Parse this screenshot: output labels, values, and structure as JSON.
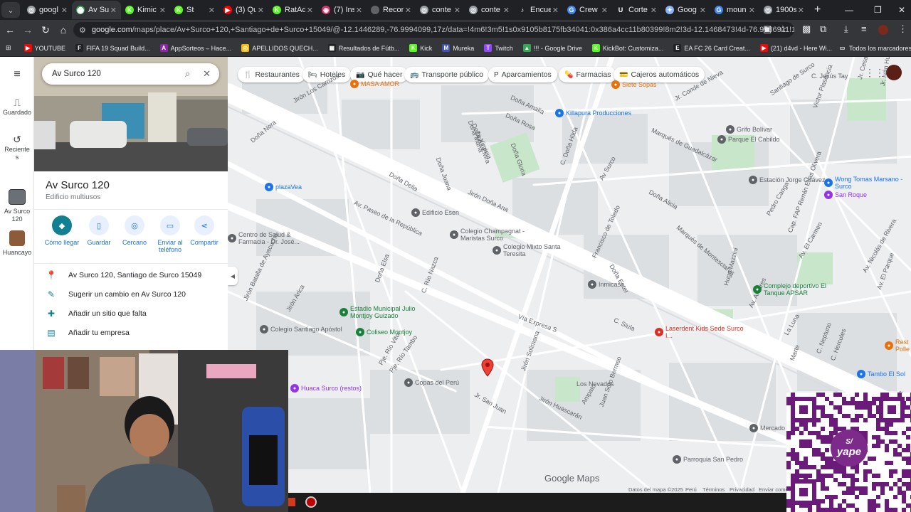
{
  "browser": {
    "tabs": [
      {
        "label": "googl",
        "color": "#9aa0a6",
        "glyph": "◎"
      },
      {
        "label": "Av Su",
        "color": "#34a853",
        "glyph": "⬤",
        "active": true
      },
      {
        "label": "Kimic",
        "color": "#53fc18",
        "glyph": "K"
      },
      {
        "label": "St",
        "color": "#53fc18",
        "glyph": "K"
      },
      {
        "label": "(3) Qu",
        "color": "#ff0000",
        "glyph": "▶"
      },
      {
        "label": "RatAd",
        "color": "#53fc18",
        "glyph": "K"
      },
      {
        "label": "(7) Ins",
        "color": "#e1306c",
        "glyph": "◉"
      },
      {
        "label": "Recon",
        "color": "#5f6368",
        "glyph": ""
      },
      {
        "label": "conte",
        "color": "#9aa0a6",
        "glyph": "◎"
      },
      {
        "label": "conte",
        "color": "#9aa0a6",
        "glyph": "◎"
      },
      {
        "label": "Encue",
        "color": "#202124",
        "glyph": "♪"
      },
      {
        "label": "Crew",
        "color": "#4285f4",
        "glyph": "G"
      },
      {
        "label": "Corte",
        "color": "#202124",
        "glyph": "U"
      },
      {
        "label": "Goog",
        "color": "#8ab4f8",
        "glyph": "✦"
      },
      {
        "label": "moun",
        "color": "#4285f4",
        "glyph": "G"
      },
      {
        "label": "1900s",
        "color": "#9aa0a6",
        "glyph": "◎"
      }
    ],
    "url_domain": "google.com",
    "url_rest": "/maps/place/Av+Surco+120,+Santiago+de+Surco+15049/@-12.1446289,-76.9994099,17z/data=!4m6!3m5!1s0x9105b8175fb34041:0x386a4cc11b80399!8m2!3d-12.1468473!4d-76.9986911!16s%2Fg%2F11j4x6zwd...",
    "bookmarks": [
      {
        "label": "YOUTUBE",
        "color": "#ff0000",
        "glyph": "▶"
      },
      {
        "label": "FIFA 19 Squad Build...",
        "color": "#202124",
        "glyph": "F"
      },
      {
        "label": "AppSorteos – Hace...",
        "color": "#8e24aa",
        "glyph": "A"
      },
      {
        "label": "APELLIDOS QUECH...",
        "color": "#fbbc04",
        "glyph": "◎"
      },
      {
        "label": "Resultados de Fútb...",
        "color": "#202124",
        "glyph": "▦"
      },
      {
        "label": "Kick",
        "color": "#53fc18",
        "glyph": "K"
      },
      {
        "label": "Mureka",
        "color": "#3f51b5",
        "glyph": "M"
      },
      {
        "label": "Twitch",
        "color": "#9146ff",
        "glyph": "T"
      },
      {
        "label": "!!! - Google Drive",
        "color": "#34a853",
        "glyph": "▲"
      },
      {
        "label": "KickBot: Customiza...",
        "color": "#53fc18",
        "glyph": "K"
      },
      {
        "label": "EA FC 26 Card Creat...",
        "color": "#202124",
        "glyph": "E"
      },
      {
        "label": "(21) d4vd - Here Wi...",
        "color": "#ff0000",
        "glyph": "▶"
      }
    ],
    "all_bookmarks": "Todos los marcadores"
  },
  "rail": {
    "saved": "Guardado",
    "recent": "Recientes",
    "recent_place": "Av Surco 120",
    "huancayo": "Huancayo"
  },
  "panel": {
    "search_value": "Av Surco 120",
    "title": "Av Surco 120",
    "subtitle": "Edificio multiusos",
    "actions": [
      {
        "label": "Cómo llegar",
        "icon": "◆"
      },
      {
        "label": "Guardar",
        "icon": "▯"
      },
      {
        "label": "Cercano",
        "icon": "◎"
      },
      {
        "label": "Enviar al teléfono",
        "icon": "▭"
      },
      {
        "label": "Compartir",
        "icon": "⋖"
      }
    ],
    "rows": [
      {
        "text": "Av Surco 120, Santiago de Surco 15049",
        "icon": "📍"
      },
      {
        "text": "Sugerir un cambio en Av Surco 120",
        "icon": "✎"
      },
      {
        "text": "Añadir un sitio que falta",
        "icon": "✚"
      },
      {
        "text": "Añadir tu empresa",
        "icon": "▤"
      }
    ]
  },
  "map": {
    "chips": [
      "Restaurantes",
      "Hoteles",
      "Qué hacer",
      "Transporte público",
      "Aparcamientos",
      "Farmacias",
      "Cajeros automáticos"
    ],
    "pois": [
      "MASA AMOR",
      "Siete Sopas",
      "Killapura Producciones",
      "Grifo Bolívar",
      "Parque El Cabildo",
      "Estación Jorge Chávez",
      "Wong Tomas Marsano - Surco",
      "San Roque",
      "plazaVea",
      "Edificio Esen",
      "Colegio Champagnat - Maristas Surco",
      "Colegio Mixto Santa Teresita",
      "Inmicash",
      "Complejo deportivo El Tanque APSAR",
      "Laserdent Kids Sede Surco I...",
      "Estadio Municipal Julio Montjoy Guizado",
      "Coliseo Montjoy",
      "Colegio Santiago Apóstol",
      "Huaca Surco (restos)",
      "Copas del Perú",
      "Mercado Sa",
      "Parroquia San Pedro",
      "Tambo El Sol",
      "Rest Polle",
      "Centro de Salud & Farmacia - Dr. José..."
    ],
    "streets": [
      "C. Jesús Tay",
      "Jr. Conde de Nieva",
      "Santiago de Surco",
      "Doña Amalia",
      "Doña Rosa",
      "Jirón Los Carrizos",
      "Doña María",
      "Doña Virginia",
      "Doña Elvira",
      "Doña Gloria",
      "Jr. Cesar Diaz",
      "Jr. Iván Huerta",
      "Victor Plasencia",
      "Marqués de Guadalcázar",
      "Vía Expresa S",
      "Av. Paseo de la República",
      "Doña Nora",
      "Doña Juana",
      "Doña Delia",
      "Jirón Doña Ana",
      "C. Doña Hilda",
      "Doña Alicia",
      "Av Surco",
      "Marqués de Montesclaros",
      "Pedro Canga",
      "Francisco de Toledo",
      "Doña Ester",
      "Cap. FAP Renán Elías Olivera",
      "Av. El Carmen",
      "Av. Nicolás de Rivera",
      "Hugo Mazzini",
      "Jirón Batalla de Ayacucho",
      "Doña Elsa",
      "C. Río Nazca",
      "Jirón Arica",
      "C. Siula",
      "Av. Antares",
      "La Luna",
      "Av. El Parque",
      "Marte",
      "Pje. Río Vitor",
      "Pje. Río Tambo",
      "Jr. San Juan",
      "Jirón Solimana",
      "Los Nevados",
      "Jirón Huascarán",
      "Ampato",
      "Juan Soto Bermeo",
      "C. Neptuno",
      "C. Hercules",
      "Av. Ayac"
    ],
    "google_maps": "Google Maps",
    "footer": [
      "Datos del mapa ©2025",
      "Perú",
      "Términos",
      "Privacidad",
      "Enviar comen"
    ]
  },
  "qr": {
    "logo_top": "S/",
    "logo_text": "yape"
  }
}
